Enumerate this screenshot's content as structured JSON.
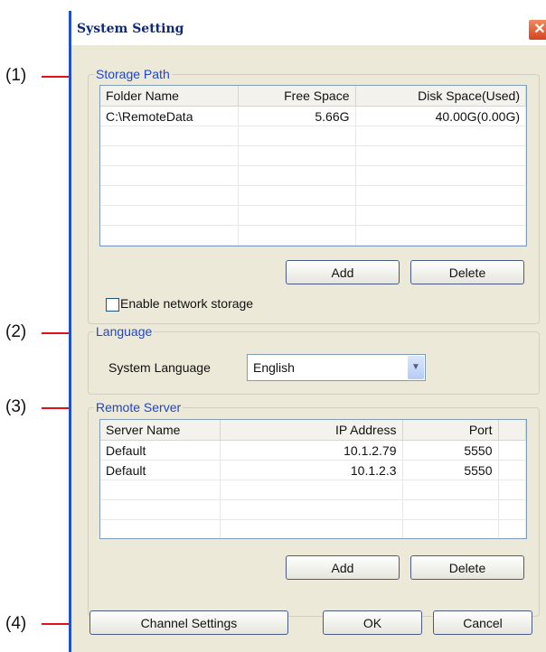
{
  "callouts": [
    "(1)",
    "(2)",
    "(3)",
    "(4)"
  ],
  "window": {
    "title": "System Setting",
    "close_glyph": "✕"
  },
  "storage": {
    "legend": "Storage Path",
    "columns": [
      "Folder Name",
      "Free Space",
      "Disk Space(Used)"
    ],
    "rows": [
      [
        "C:\\RemoteData",
        "5.66G",
        "40.00G(0.00G)"
      ]
    ],
    "add_label": "Add",
    "delete_label": "Delete",
    "enable_network_label": "Enable network storage",
    "enable_network_checked": false
  },
  "language": {
    "legend": "Language",
    "system_language_label": "System Language",
    "selected": "English"
  },
  "remote": {
    "legend": "Remote Server",
    "columns": [
      "Server Name",
      "IP Address",
      "Port"
    ],
    "rows": [
      [
        "Default",
        "10.1.2.79",
        "5550"
      ],
      [
        "Default",
        "10.1.2.3",
        "5550"
      ]
    ],
    "add_label": "Add",
    "delete_label": "Delete"
  },
  "footer": {
    "channel_settings_label": "Channel Settings",
    "ok_label": "OK",
    "cancel_label": "Cancel"
  },
  "colors": {
    "callout_line": "#e0101a",
    "legend_text": "#1e46c8",
    "title_text": "#0d2a7a"
  }
}
